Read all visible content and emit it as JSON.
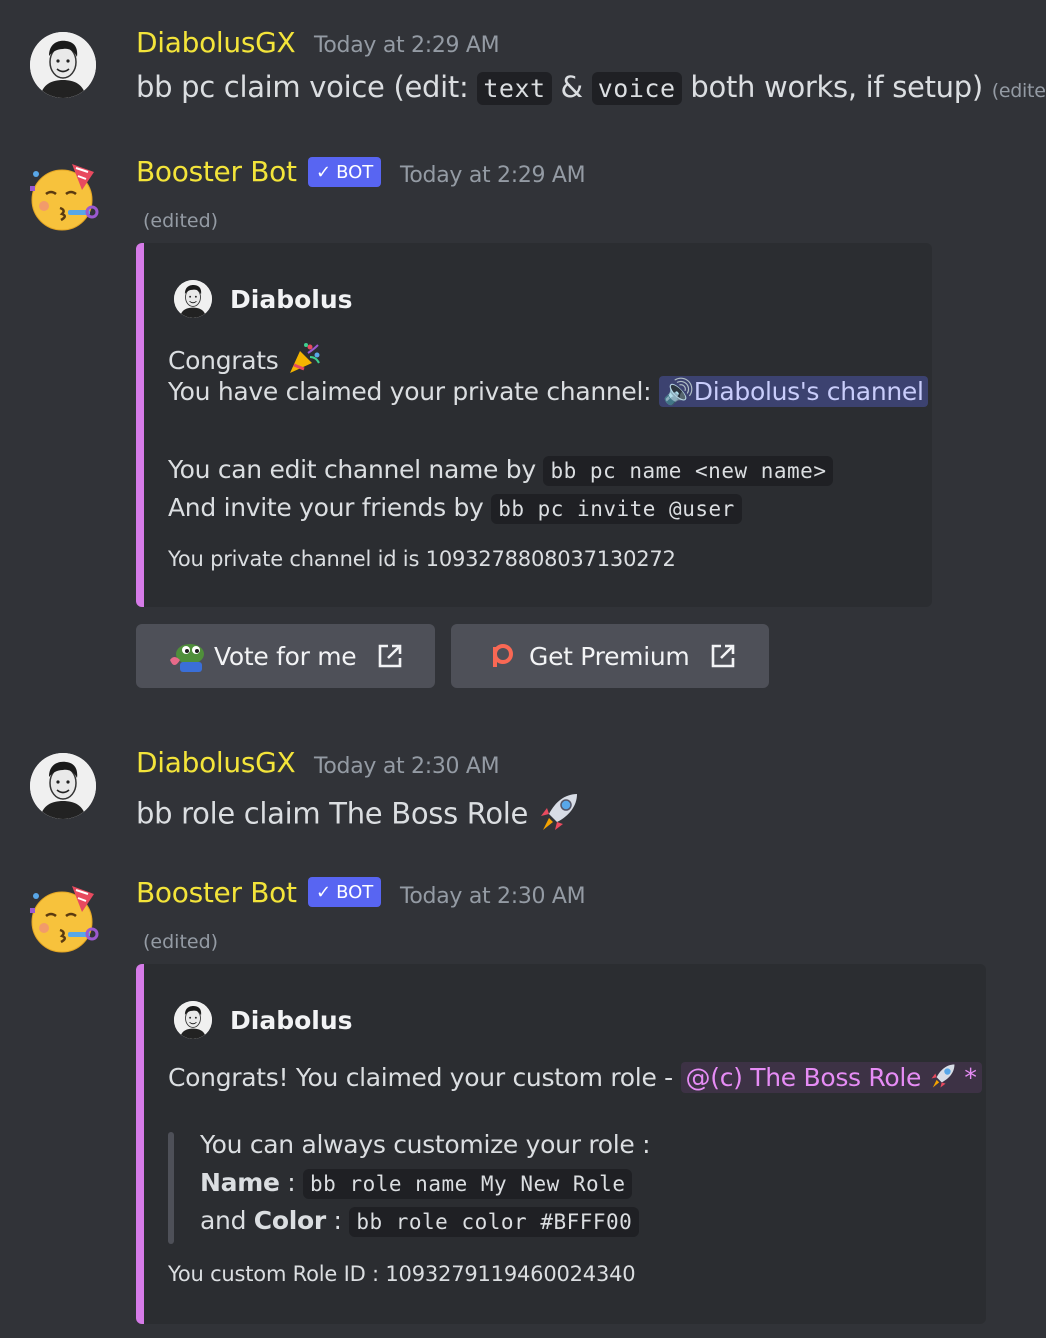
{
  "messages": [
    {
      "author": "DiabolusGX",
      "timestamp": "Today at 2:29 AM",
      "content_pre": "bb pc claim voice (edit: ",
      "code1": "text",
      "content_mid": " & ",
      "code2": "voice",
      "content_post": " both works, if setup)",
      "edited": "(edited)"
    },
    {
      "author": "Booster Bot",
      "badge": "BOT",
      "timestamp": "Today at 2:29 AM",
      "edited": "(edited)",
      "embed": {
        "author": "Diabolus",
        "line1": "Congrats",
        "line2_pre": "You have claimed your private channel: ",
        "channel": "Diabolus's channel",
        "line3_pre": "You can edit channel name by ",
        "line3_code": "bb pc name <new name>",
        "line4_pre": "And invite your friends by ",
        "line4_code": "bb pc invite @user",
        "line5": "You private channel id is 1093278808037130272"
      },
      "buttons": [
        {
          "label": "Vote for me",
          "icon": "pepe-emoji"
        },
        {
          "label": "Get Premium",
          "icon": "patreon-icon"
        }
      ]
    },
    {
      "author": "DiabolusGX",
      "timestamp": "Today at 2:30 AM",
      "content": "bb role claim The Boss Role"
    },
    {
      "author": "Booster Bot",
      "badge": "BOT",
      "timestamp": "Today at 2:30 AM",
      "edited": "(edited)",
      "embed": {
        "author": "Diabolus",
        "line1_pre": "Congrats! You claimed your custom role - ",
        "role": "@(c) The Boss Role",
        "role_suffix": "*",
        "quote_line1": "You can always customize your role :",
        "quote_name_bold": "Name",
        "quote_name_sep": " : ",
        "quote_name_code": "bb role name My New Role",
        "quote_color_pre": "and ",
        "quote_color_bold": "Color",
        "quote_color_sep": " : ",
        "quote_color_code": "bb role color #BFFF00",
        "footer": "You custom Role ID : 1093279119460024340"
      }
    }
  ],
  "colors": {
    "background": "#313338",
    "username": "#f3e43a",
    "embed_border": "#d67be8",
    "bot_badge": "#5865f2"
  }
}
